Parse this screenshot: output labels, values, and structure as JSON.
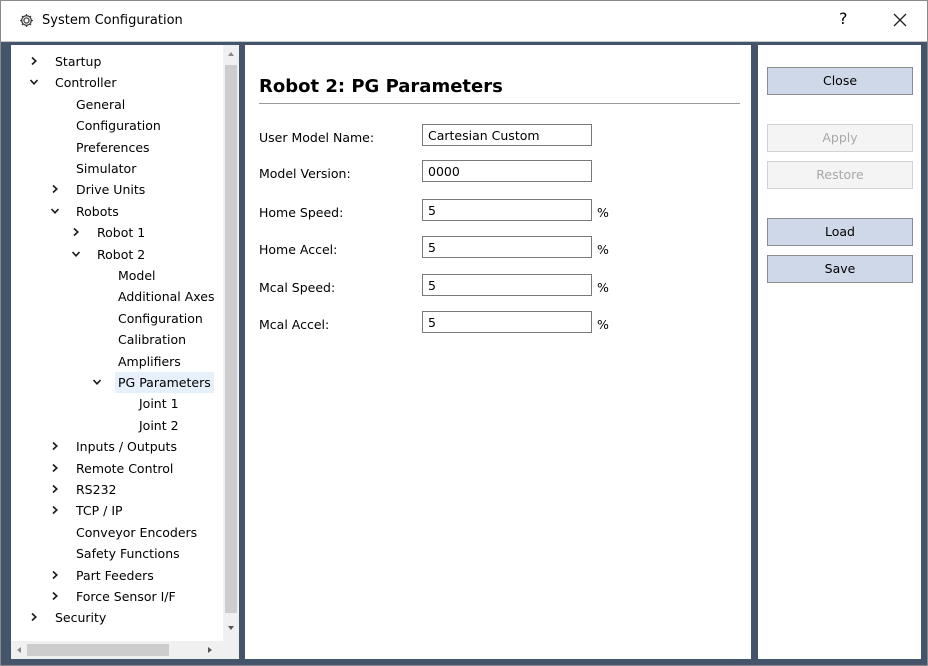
{
  "window": {
    "title": "System Configuration",
    "help_glyph": "?"
  },
  "tree": {
    "items": [
      {
        "label": "Startup",
        "level": 0,
        "expander": "collapsed"
      },
      {
        "label": "Controller",
        "level": 0,
        "expander": "expanded"
      },
      {
        "label": "General",
        "level": 1,
        "expander": "none"
      },
      {
        "label": "Configuration",
        "level": 1,
        "expander": "none"
      },
      {
        "label": "Preferences",
        "level": 1,
        "expander": "none"
      },
      {
        "label": "Simulator",
        "level": 1,
        "expander": "none"
      },
      {
        "label": "Drive Units",
        "level": 1,
        "expander": "collapsed"
      },
      {
        "label": "Robots",
        "level": 1,
        "expander": "expanded"
      },
      {
        "label": "Robot 1",
        "level": 2,
        "expander": "collapsed"
      },
      {
        "label": "Robot 2",
        "level": 2,
        "expander": "expanded"
      },
      {
        "label": "Model",
        "level": 3,
        "expander": "none"
      },
      {
        "label": "Additional Axes",
        "level": 3,
        "expander": "none"
      },
      {
        "label": "Configuration",
        "level": 3,
        "expander": "none"
      },
      {
        "label": "Calibration",
        "level": 3,
        "expander": "none"
      },
      {
        "label": "Amplifiers",
        "level": 3,
        "expander": "none"
      },
      {
        "label": "PG Parameters",
        "level": 3,
        "expander": "expanded",
        "selected": true
      },
      {
        "label": "Joint 1",
        "level": 4,
        "expander": "none"
      },
      {
        "label": "Joint 2",
        "level": 4,
        "expander": "none"
      },
      {
        "label": "Inputs / Outputs",
        "level": 1,
        "expander": "collapsed"
      },
      {
        "label": "Remote Control",
        "level": 1,
        "expander": "collapsed"
      },
      {
        "label": "RS232",
        "level": 1,
        "expander": "collapsed"
      },
      {
        "label": "TCP / IP",
        "level": 1,
        "expander": "collapsed"
      },
      {
        "label": "Conveyor Encoders",
        "level": 1,
        "expander": "none"
      },
      {
        "label": "Safety Functions",
        "level": 1,
        "expander": "none"
      },
      {
        "label": "Part Feeders",
        "level": 1,
        "expander": "collapsed"
      },
      {
        "label": "Force Sensor I/F",
        "level": 1,
        "expander": "collapsed"
      },
      {
        "label": "Security",
        "level": 0,
        "expander": "collapsed"
      }
    ]
  },
  "main": {
    "title": "Robot 2: PG Parameters",
    "fields": [
      {
        "label": "User Model Name:",
        "value": "Cartesian Custom",
        "unit": "",
        "wide": false
      },
      {
        "label": "Model Version:",
        "value": "0000",
        "unit": "",
        "wide": false
      },
      {
        "label": "Home Speed:",
        "value": "5",
        "unit": "%",
        "wide": true
      },
      {
        "label": "Home Accel:",
        "value": "5",
        "unit": "%",
        "wide": true
      },
      {
        "label": "Mcal Speed:",
        "value": "5",
        "unit": "%",
        "wide": true
      },
      {
        "label": "Mcal Accel:",
        "value": "5",
        "unit": "%",
        "wide": true
      }
    ]
  },
  "buttons": {
    "close": {
      "label": "Close",
      "enabled": true
    },
    "apply": {
      "label": "Apply",
      "enabled": false
    },
    "restore": {
      "label": "Restore",
      "enabled": false
    },
    "load": {
      "label": "Load",
      "enabled": true
    },
    "save": {
      "label": "Save",
      "enabled": true
    }
  },
  "colors": {
    "frame_background": "#44546a",
    "button_face": "#cfd8e8",
    "selection": "#e5f0fb"
  }
}
